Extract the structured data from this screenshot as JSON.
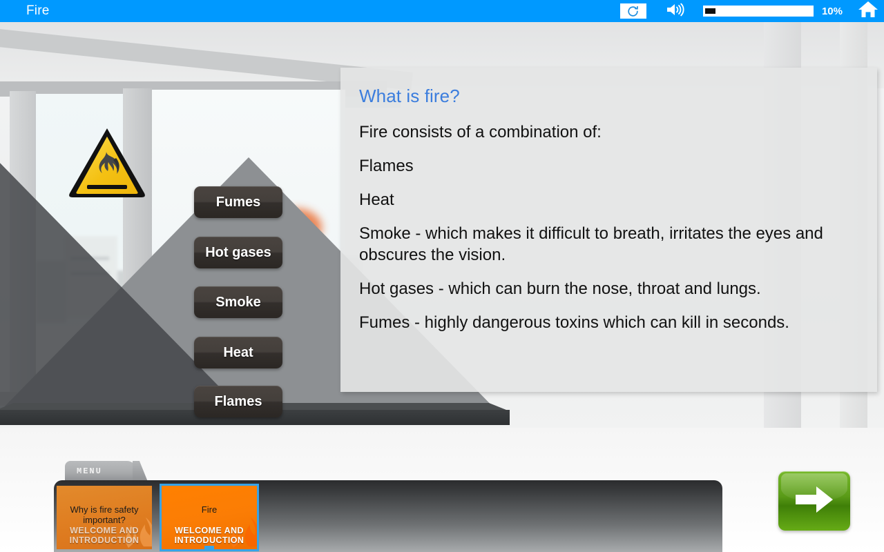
{
  "topbar": {
    "title": "Fire",
    "replay_icon": "replay-icon",
    "speaker_icon": "speaker-icon",
    "home_icon": "home-icon",
    "progress_percent": 10,
    "progress_label": "10%"
  },
  "scene": {
    "hazard_icon": "flammable-hazard-icon",
    "pyramid": {
      "tiers": [
        {
          "label": "Fumes"
        },
        {
          "label": "Hot gases"
        },
        {
          "label": "Smoke"
        },
        {
          "label": "Heat"
        },
        {
          "label": "Flames"
        }
      ]
    }
  },
  "panel": {
    "heading": "What is fire?",
    "paragraphs": [
      "Fire consists of a combination of:",
      "Flames",
      "Heat",
      "Smoke - which makes it difficult to breath, irritates the eyes and obscures the vision.",
      "Hot gases - which can burn the nose, throat and lungs.",
      "Fumes - highly dangerous toxins which can kill in seconds."
    ],
    "heading_color": "#3b7ddd"
  },
  "bottom": {
    "menu_tab_label": "MENU",
    "thumbnails": [
      {
        "title": "Why is fire safety important?",
        "subtitle": "WELCOME AND INTRODUCTION",
        "selected": false
      },
      {
        "title": "Fire",
        "subtitle": "WELCOME AND INTRODUCTION",
        "selected": true
      }
    ],
    "next_icon": "arrow-right-icon"
  },
  "colors": {
    "accent_blue": "#0099ff",
    "selected_outline": "#36a3e8",
    "next_green": "#5a9b18",
    "hazard_yellow": "#f2c018"
  }
}
